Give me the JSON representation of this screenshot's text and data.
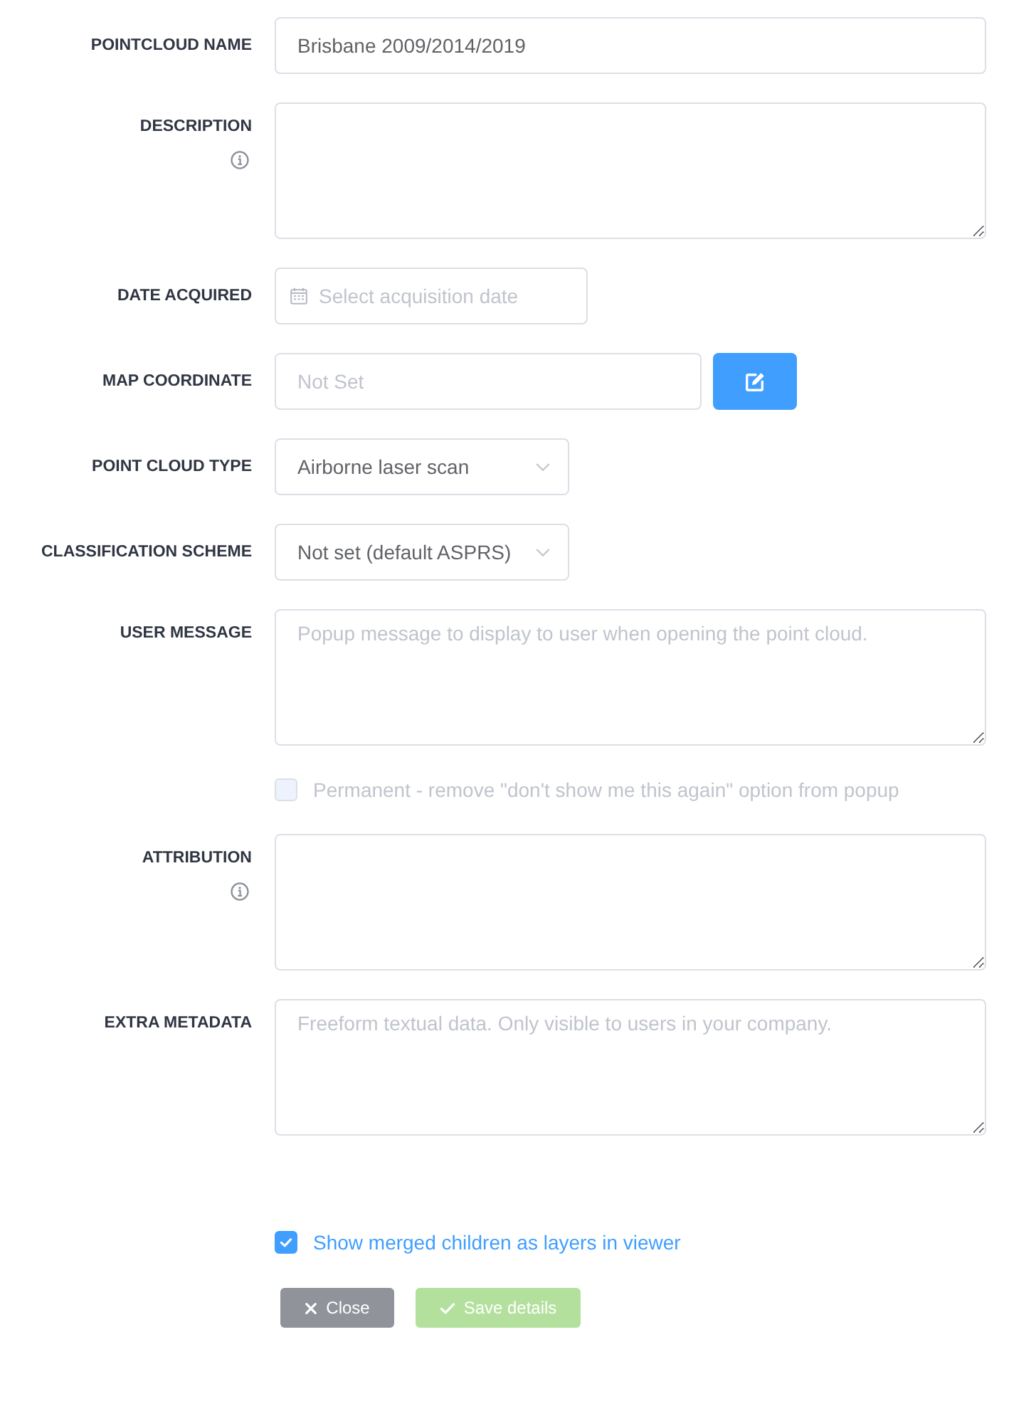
{
  "fields": [
    {
      "kind": "text",
      "label": "POINTCLOUD NAME",
      "info": false,
      "value": "Brisbane 2009/2014/2019"
    },
    {
      "kind": "textarea",
      "label": "DESCRIPTION",
      "info": true
    },
    {
      "kind": "date",
      "label": "DATE ACQUIRED",
      "info": false,
      "placeholder": "Select acquisition date"
    },
    {
      "kind": "coordinate",
      "label": "MAP COORDINATE",
      "info": false,
      "placeholder": "Not Set"
    },
    {
      "kind": "select",
      "label": "POINT CLOUD TYPE",
      "info": false,
      "value": "Airborne laser scan"
    },
    {
      "kind": "select",
      "label": "CLASSIFICATION SCHEME",
      "info": false,
      "value": "Not set (default ASPRS)"
    },
    {
      "kind": "textarea",
      "label": "USER MESSAGE",
      "info": false,
      "placeholder": "Popup message to display to user when opening the point cloud."
    },
    {
      "kind": "checkbox",
      "label": "Permanent - remove \"don't show me this again\" option from popup",
      "checked": false,
      "disabled": true
    },
    {
      "kind": "textarea",
      "label": "ATTRIBUTION",
      "info": true
    },
    {
      "kind": "textarea",
      "label": "EXTRA METADATA",
      "info": false,
      "placeholder": "Freeform textual data. Only visible to users in your company."
    }
  ],
  "layers_option": {
    "label": "Show merged children as layers in viewer",
    "checked": true,
    "disabled": false
  },
  "buttons": [
    {
      "kind": "close",
      "label": "Close",
      "disabled": false
    },
    {
      "kind": "save",
      "label": "Save details",
      "disabled": true
    }
  ]
}
